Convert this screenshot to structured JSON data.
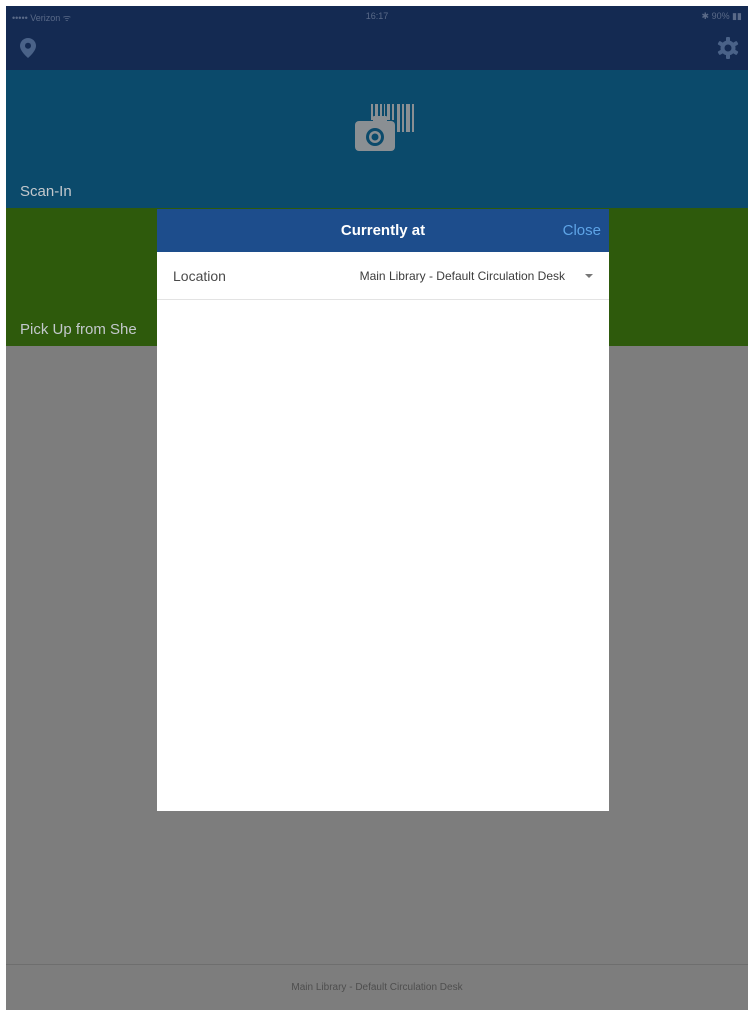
{
  "status_bar": {
    "carrier": "••••• Verizon ᯤ",
    "time": "16:17",
    "battery": "✱ 90% ▮▮"
  },
  "nav": {
    "left_icon": "location-pin-icon",
    "right_icon": "gear-icon"
  },
  "tiles": [
    {
      "label": "Scan-In",
      "color": "#0b4a6b",
      "icon": "barcode-camera-icon"
    },
    {
      "label": "Pick Up from She",
      "color": "#2e5a0c"
    }
  ],
  "modal": {
    "title": "Currently at",
    "close_label": "Close",
    "location_label": "Location",
    "location_value": "Main Library - Default Circulation Desk"
  },
  "footer": {
    "text": "Main Library - Default Circulation Desk"
  },
  "colors": {
    "nav_bg": "#142a52",
    "modal_header": "#1d4d8c",
    "close_link": "#5ea4e6",
    "overlay": "#7d7d7d"
  }
}
